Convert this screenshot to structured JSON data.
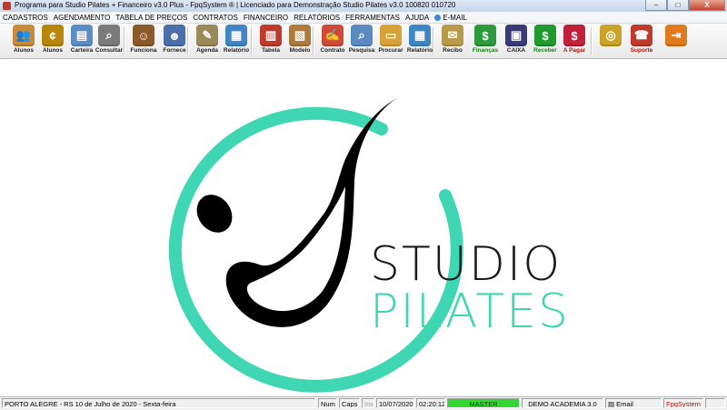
{
  "window": {
    "title": "Programa para Studio Pilates + Financeiro v3.0 Plus - FpqSystem ® | Licenciado para  Demonstração Studio Pilates v3.0 100820 010720",
    "minimize_label": "‒",
    "maximize_label": "□",
    "close_label": "X"
  },
  "menu": {
    "items": [
      "CADASTROS",
      "AGENDAMENTO",
      "TABELA DE PREÇOS",
      "CONTRATOS",
      "FINANCEIRO",
      "RELATÓRIOS",
      "FERRAMENTAS",
      "AJUDA"
    ],
    "email_label": "E-MAIL"
  },
  "toolbar": {
    "buttons": [
      {
        "label": "Alunos",
        "icon": "students-icon",
        "glyph": "👥",
        "color": "#c98a3a"
      },
      {
        "label": "Alunos",
        "icon": "coin-icon",
        "glyph": "¢",
        "color": "#b8860b"
      },
      {
        "label": "Carteira",
        "icon": "id-card-icon",
        "glyph": "▤",
        "color": "#5b8ec9"
      },
      {
        "label": "Consultar",
        "icon": "search-user-icon",
        "glyph": "⌕",
        "color": "#7a7a7a"
      },
      {
        "label": "Funciona",
        "icon": "employee-icon",
        "glyph": "☺",
        "color": "#8a5a2b"
      },
      {
        "label": "Fornece",
        "icon": "supplier-icon",
        "glyph": "☻",
        "color": "#4b6fa8"
      },
      {
        "label": "Agenda",
        "icon": "calendar-icon",
        "glyph": "✎",
        "color": "#9a8a5a"
      },
      {
        "label": "Relatório",
        "icon": "report-icon",
        "glyph": "▦",
        "color": "#3f86c8"
      },
      {
        "label": "Tabela",
        "icon": "price-table-icon",
        "glyph": "▥",
        "color": "#c0392b"
      },
      {
        "label": "Modelo",
        "icon": "template-icon",
        "glyph": "▧",
        "color": "#b07a3a"
      },
      {
        "label": "Contrato",
        "icon": "contract-icon",
        "glyph": "✍",
        "color": "#d04a3a"
      },
      {
        "label": "Pesquisa",
        "icon": "search-doc-icon",
        "glyph": "⌕",
        "color": "#5a8ac0"
      },
      {
        "label": "Procurar",
        "icon": "folder-icon",
        "glyph": "▭",
        "color": "#d9a13a"
      },
      {
        "label": "Relatório",
        "icon": "report-box-icon",
        "glyph": "▦",
        "color": "#3f86c8"
      },
      {
        "label": "Recibo",
        "icon": "receipt-icon",
        "glyph": "✉",
        "color": "#b89a4a"
      },
      {
        "label": "Finanças",
        "icon": "finance-icon",
        "glyph": "$",
        "color": "#2e9a3e"
      },
      {
        "label": "CAIXA",
        "icon": "cashbox-icon",
        "glyph": "▣",
        "color": "#3a3a7a"
      },
      {
        "label": "Receber",
        "icon": "receive-icon",
        "glyph": "$",
        "color": "#1f9a2f"
      },
      {
        "label": "A Pagar",
        "icon": "pay-icon",
        "glyph": "$",
        "color": "#c0203a"
      },
      {
        "label": "",
        "icon": "gold-coin-icon",
        "glyph": "◎",
        "color": "#c9a227"
      },
      {
        "label": "Suporte",
        "icon": "support-icon",
        "glyph": "☎",
        "color": "#c0392b"
      },
      {
        "label": "",
        "icon": "exit-icon",
        "glyph": "⇥",
        "color": "#e07a1a"
      }
    ]
  },
  "logo": {
    "line1": "STUDIO",
    "line2": "PILATES",
    "ring_color": "#3fd6b3",
    "figure_color": "#000000"
  },
  "status": {
    "location": "PORTO ALEGRE - RS 10 de Julho de 2020 - Sexta-feira",
    "num": "Num",
    "caps": "Caps",
    "ins": "Ins",
    "date": "10/07/2020",
    "time": "02:20:12",
    "user": "MASTER",
    "company": "DEMO ACADEMIA 3.0",
    "email": "Email",
    "brand": "FpqSystem"
  }
}
